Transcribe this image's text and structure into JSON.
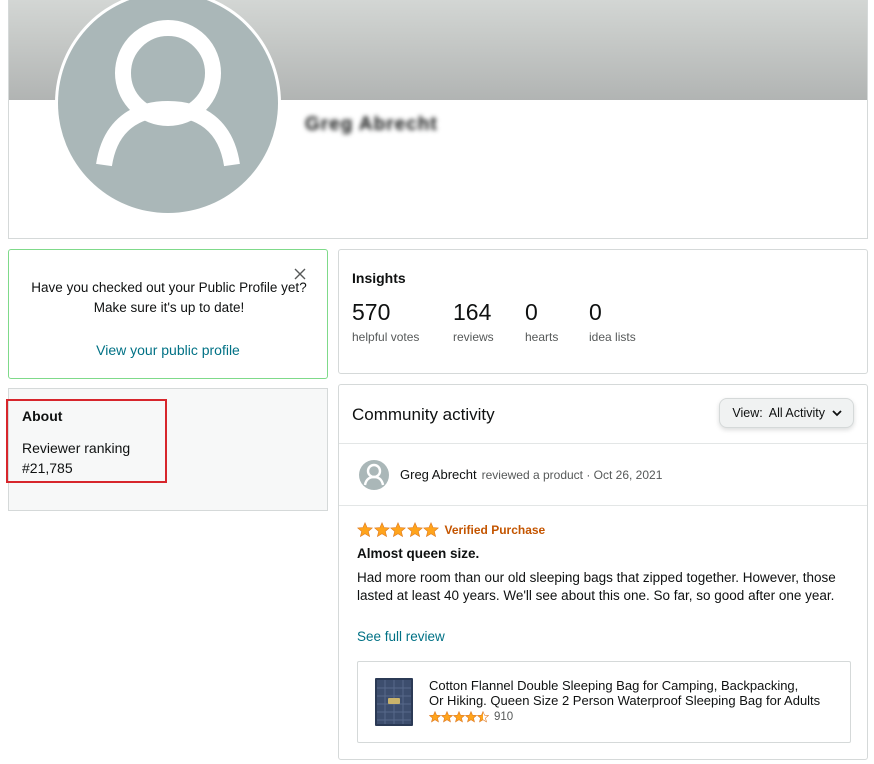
{
  "profile": {
    "name": "Greg Abrecht"
  },
  "promo": {
    "message": "Have you checked out your Public Profile yet? Make sure it's up to date!",
    "link": "View your public profile"
  },
  "about": {
    "title": "About",
    "ranking_label": "Reviewer ranking",
    "ranking_value": "#21,785"
  },
  "insights": {
    "title": "Insights",
    "stats": [
      {
        "value": "570",
        "label": "helpful votes"
      },
      {
        "value": "164",
        "label": "reviews"
      },
      {
        "value": "0",
        "label": "hearts"
      },
      {
        "value": "0",
        "label": "idea lists"
      }
    ]
  },
  "community": {
    "title": "Community activity",
    "view_label": "View:",
    "view_value": "All Activity",
    "activity": {
      "user": "Greg Abrecht",
      "action": "reviewed a product · Oct 26, 2021",
      "rating": 5,
      "verified": "Verified Purchase",
      "review_title": "Almost queen size.",
      "review_body": "Had more room than our old sleeping bags that zipped together. However, those lasted at least 40 years. We'll see about this one. So far, so good after one year.",
      "see_full": "See full review",
      "product": {
        "title_line1": "Cotton Flannel Double Sleeping Bag for Camping, Backpacking,",
        "title_line2": "Or Hiking. Queen Size 2 Person Waterproof Sleeping Bag for Adults",
        "rating": 4.5,
        "rating_count": "910"
      }
    }
  },
  "colors": {
    "link": "#007185",
    "star": "#ffa41c",
    "verified": "#c45500",
    "promo_border": "#7fda8a",
    "highlight": "#d7262c"
  }
}
